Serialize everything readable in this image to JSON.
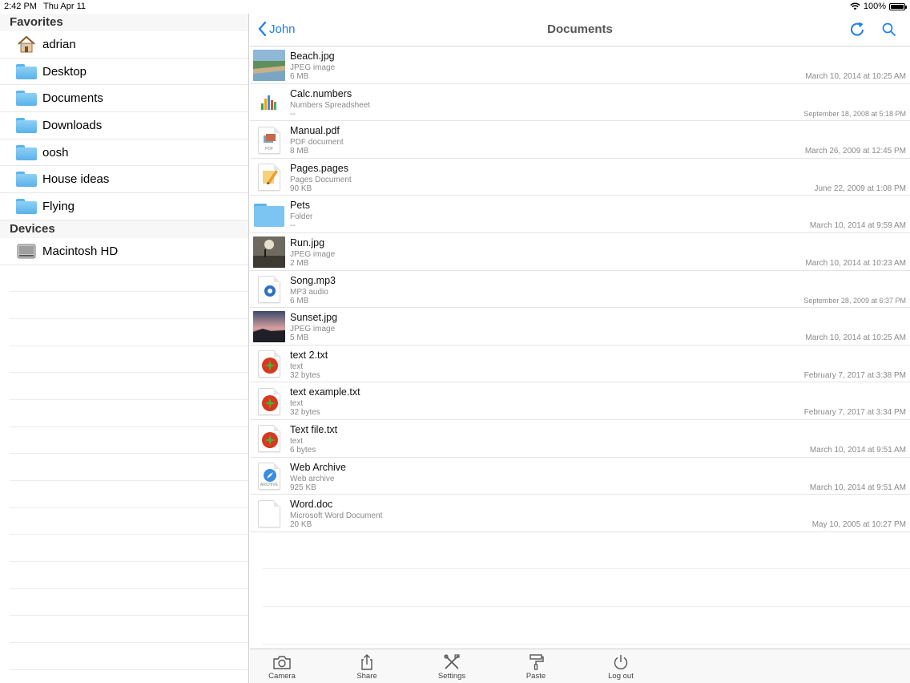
{
  "status_bar": {
    "time": "2:42 PM",
    "date": "Thu Apr 11",
    "battery_text": "100%",
    "battery_level": 1.0
  },
  "sidebar": {
    "favorites_header": "Favorites",
    "favorites": [
      {
        "label": "adrian",
        "icon": "home-icon"
      },
      {
        "label": "Desktop",
        "icon": "folder-icon"
      },
      {
        "label": "Documents",
        "icon": "folder-icon"
      },
      {
        "label": "Downloads",
        "icon": "folder-icon"
      },
      {
        "label": "oosh",
        "icon": "folder-icon"
      },
      {
        "label": "House ideas",
        "icon": "folder-icon"
      },
      {
        "label": "Flying",
        "icon": "folder-icon"
      }
    ],
    "devices_header": "Devices",
    "devices": [
      {
        "label": "Macintosh HD",
        "icon": "hard-drive-icon"
      }
    ]
  },
  "navbar": {
    "back_label": "John",
    "title": "Documents"
  },
  "files": [
    {
      "name": "Beach.jpg",
      "type": "JPEG image",
      "size": "6 MB",
      "date": "March 10, 2014 at 10:25 AM",
      "icon": "beach-photo"
    },
    {
      "name": "Calc.numbers",
      "type": "Numbers Spreadsheet",
      "size": "--",
      "date": "September 18, 2008 at 5:18 PM",
      "icon": "numbers-icon"
    },
    {
      "name": "Manual.pdf",
      "type": "PDF document",
      "size": "8 MB",
      "date": "March 26, 2009 at 12:45 PM",
      "icon": "pdf-icon"
    },
    {
      "name": "Pages.pages",
      "type": "Pages Document",
      "size": "90 KB",
      "date": "June 22, 2009 at 1:08 PM",
      "icon": "pages-icon"
    },
    {
      "name": "Pets",
      "type": "Folder",
      "size": "--",
      "date": "March 10, 2014 at 9:59 AM",
      "icon": "folder-icon"
    },
    {
      "name": "Run.jpg",
      "type": "JPEG image",
      "size": "2 MB",
      "date": "March 10, 2014 at 10:23 AM",
      "icon": "run-photo"
    },
    {
      "name": "Song.mp3",
      "type": "MP3 audio",
      "size": "6 MB",
      "date": "September 28, 2009 at 6:37 PM",
      "icon": "audio-icon"
    },
    {
      "name": "Sunset.jpg",
      "type": "JPEG image",
      "size": "5 MB",
      "date": "March 10, 2014 at 10:25 AM",
      "icon": "sunset-photo"
    },
    {
      "name": "text 2.txt",
      "type": "text",
      "size": "32 bytes",
      "date": "February 7, 2017 at 3:38 PM",
      "icon": "text-icon"
    },
    {
      "name": "text example.txt",
      "type": "text",
      "size": "32 bytes",
      "date": "February 7, 2017 at 3:34 PM",
      "icon": "text-icon"
    },
    {
      "name": "Text file.txt",
      "type": "text",
      "size": "6 bytes",
      "date": "March 10, 2014 at 9:51 AM",
      "icon": "text-icon"
    },
    {
      "name": "Web Archive",
      "type": "Web archive",
      "size": "925 KB",
      "date": "March 10, 2014 at 9:51 AM",
      "icon": "web-archive-icon"
    },
    {
      "name": "Word.doc",
      "type": "Microsoft Word Document",
      "size": "20 KB",
      "date": "May 10, 2005 at 10:27 PM",
      "icon": "word-icon"
    }
  ],
  "file_icon_labels": {
    "pdf": "PDF",
    "archive": "ARCHIVE"
  },
  "tabbar": {
    "camera": "Camera",
    "share": "Share",
    "settings": "Settings",
    "paste": "Paste",
    "logout": "Log out"
  },
  "colors": {
    "accent": "#1a7ef5",
    "folder": "#5ab2ea",
    "text_icon": "#d8381f"
  }
}
